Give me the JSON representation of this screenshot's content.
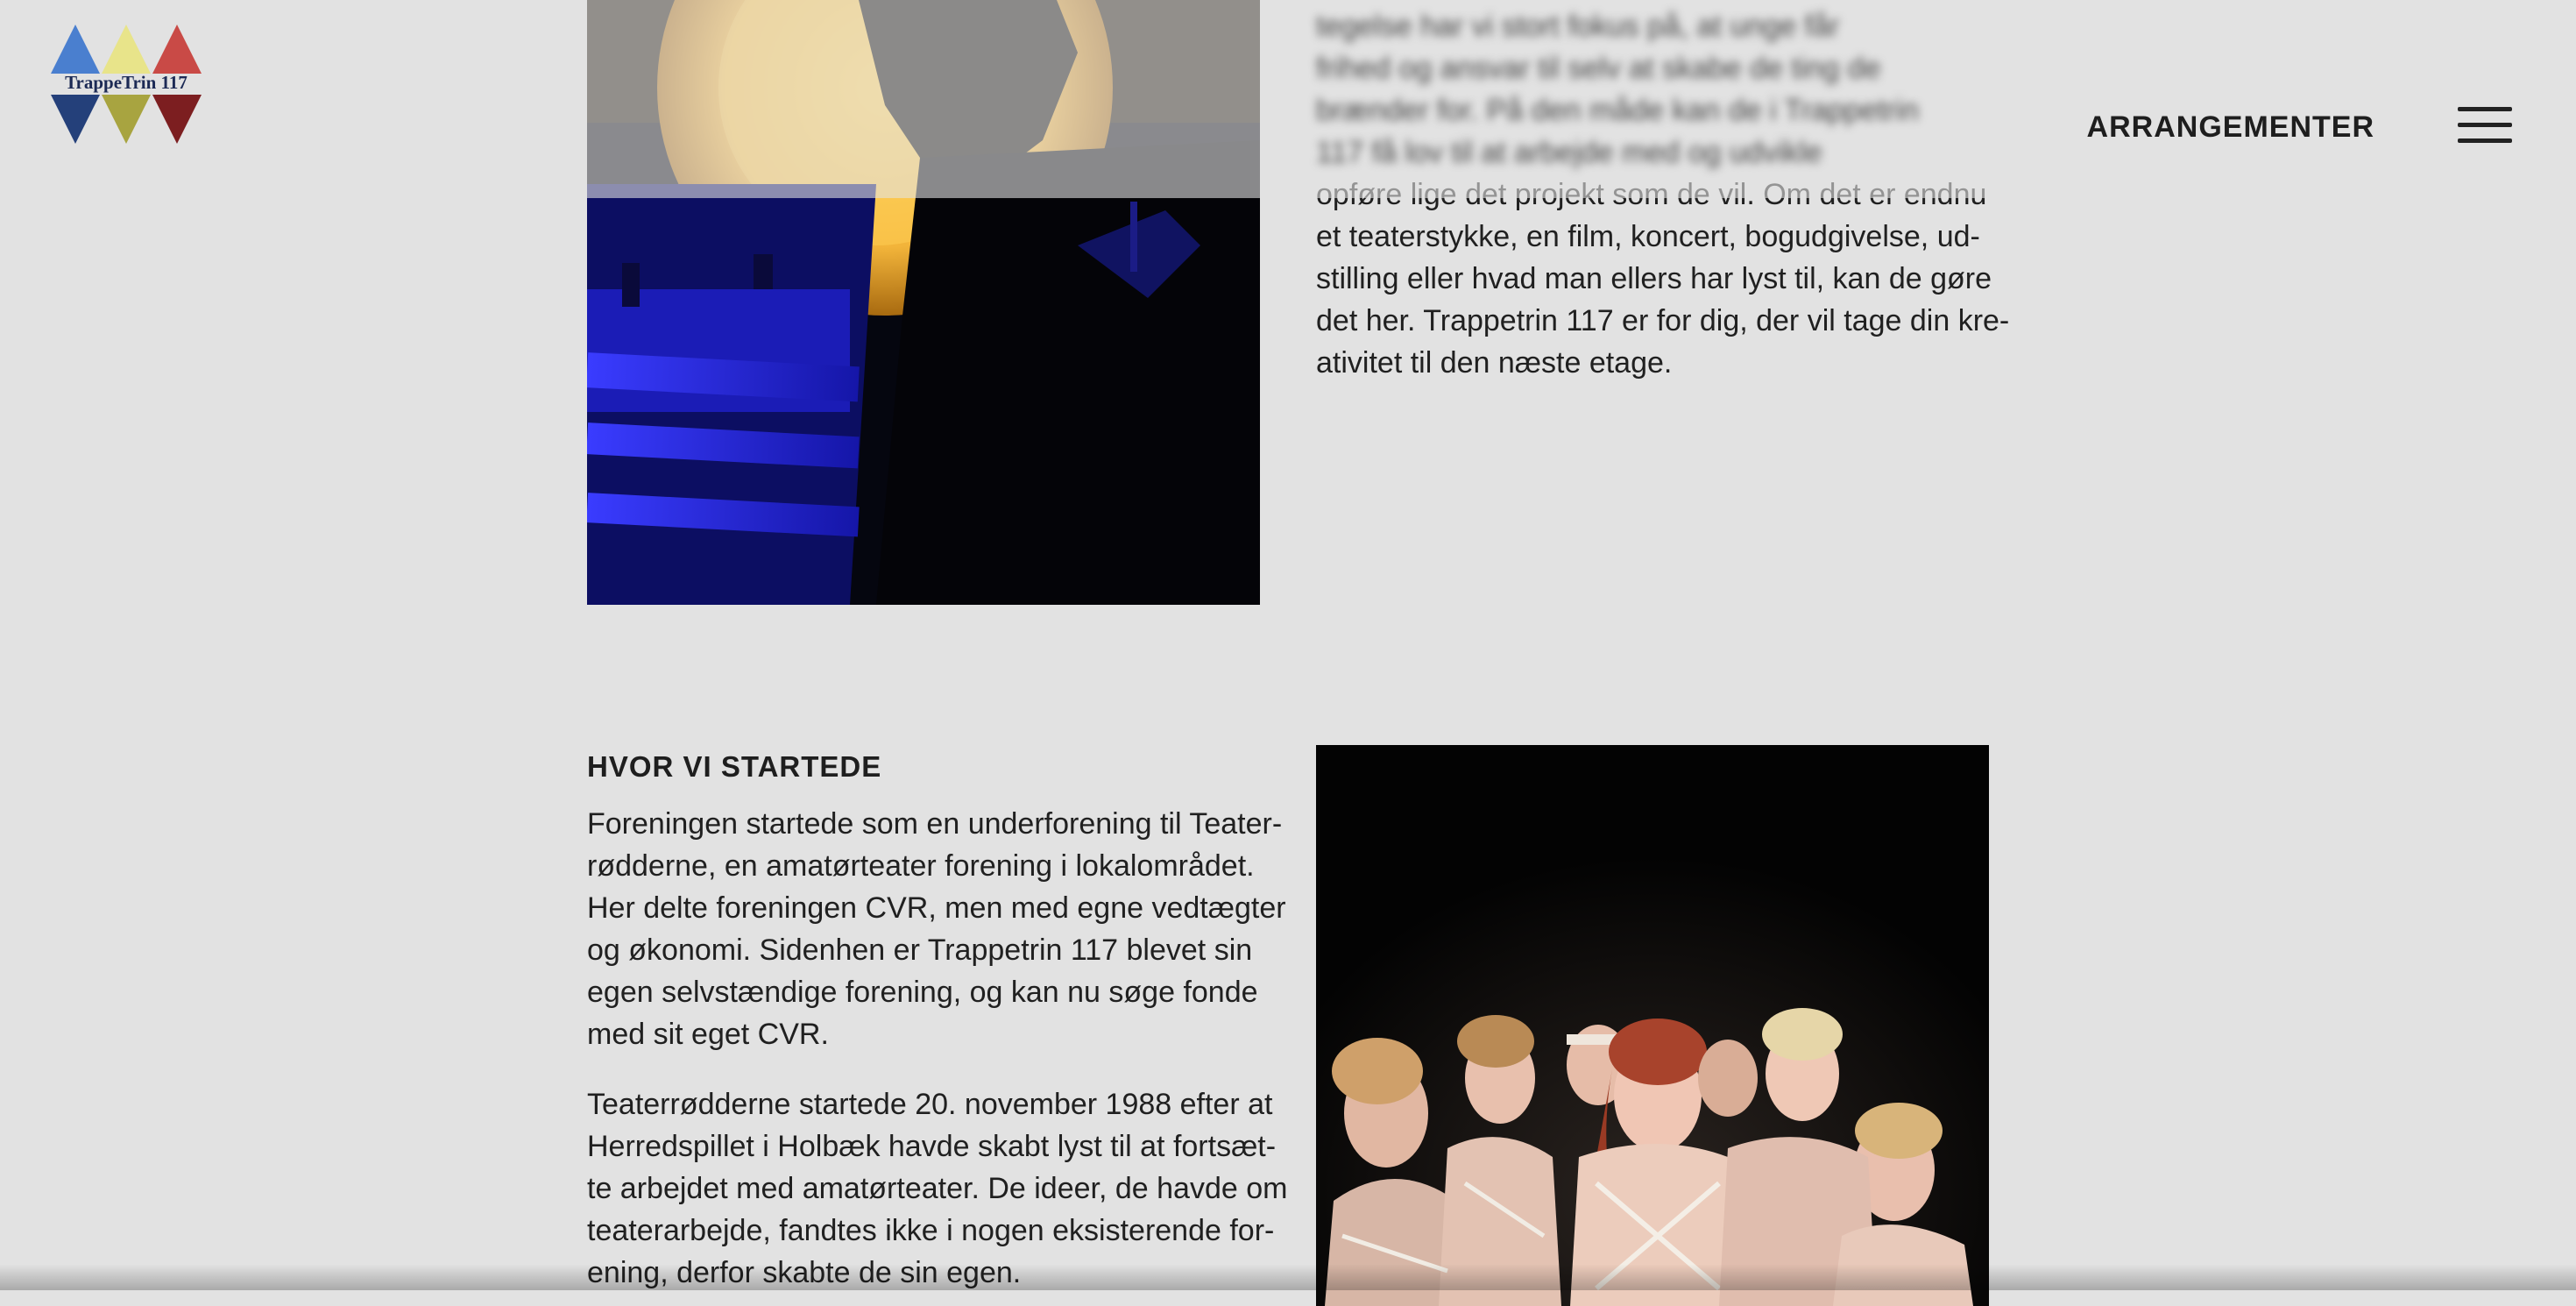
{
  "header": {
    "logo_text": "TrappeTrin 117",
    "nav_label": "ARRANGEMENTER",
    "menu_icon": "hamburger-menu-icon"
  },
  "intro": {
    "lines_hidden": [
      "tegelse har vi stort fokus på, at unge får",
      "frihed og ansvar til selv at skabe de ting de",
      "brænder for. På den måde kan de i Trappetrin",
      "117 få lov til at arbejde med og udvikle"
    ],
    "lines": [
      "opføre lige det projekt som de vil. Om det er endnu",
      "et teaterstykke, en film, koncert, bogudgivelse, ud-",
      "stilling eller hvad man ellers har lyst til, kan de gøre",
      "det her. Trappetrin 117 er for dig, der vil tage din kre-",
      "ativitet til den næste etage."
    ]
  },
  "section": {
    "heading": "HVOR VI STARTEDE",
    "para1": [
      "Foreningen startede som en underforening til Teater-",
      "rødderne, en amatørteater forening i lokalområdet.",
      "Her delte foreningen CVR, men med egne vedtægter",
      "og økonomi. Sidenhen er Trappetrin 117 blevet sin",
      "egen selvstændige forening, og kan nu søge fonde",
      "med sit eget CVR."
    ],
    "para2": [
      "Teaterrødderne startede 20. november 1988 efter at",
      "Herredspillet i Holbæk havde skabt lyst til at fortsæt-",
      "te arbejdet med amatørteater. De ideer, de havde om",
      "teaterarbejde, fandtes ikke i nogen eksisterende for-",
      "ening, derfor skabte de sin egen."
    ]
  },
  "colors": {
    "background": "#e2e2e2",
    "logo_blue": "#4a7fcf",
    "logo_yellow": "#e8e48a",
    "logo_red": "#c94a46",
    "stage_blue": "#2a2cf0",
    "stage_yellow": "#f0b030"
  }
}
